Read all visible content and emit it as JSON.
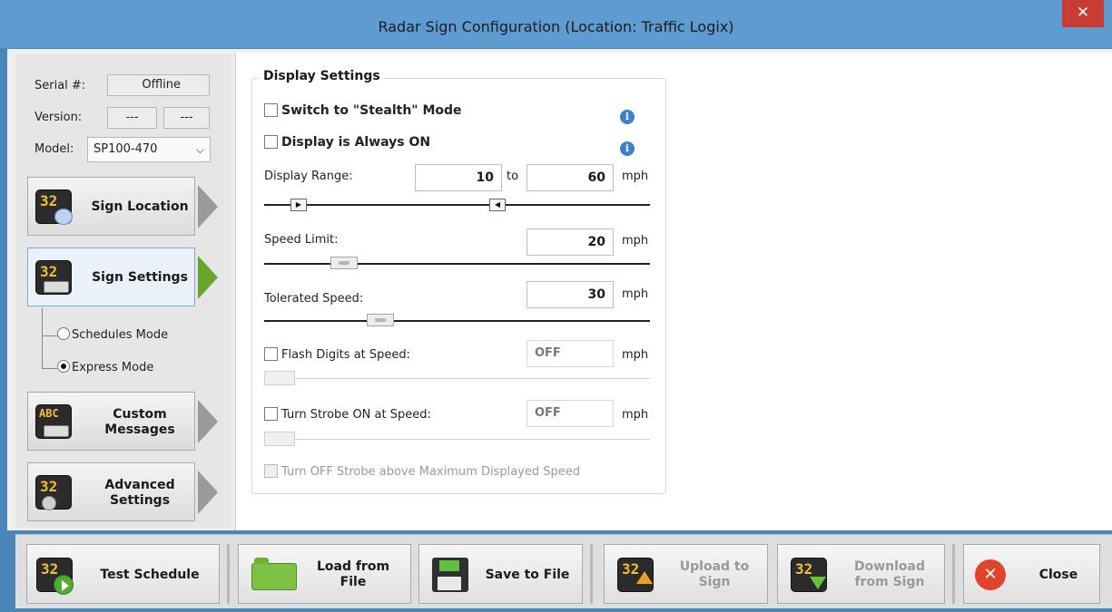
{
  "window": {
    "title": "Radar Sign Configuration (Location: Traffic Logix)",
    "close_glyph": "✕"
  },
  "device": {
    "serial_label": "Serial #:",
    "serial_value": "Offline",
    "version_label": "Version:",
    "version_value_1": "---",
    "version_value_2": "---",
    "model_label": "Model:",
    "model_value": "SP100-470"
  },
  "nav": {
    "items": [
      {
        "label": "Sign Location",
        "icon": "sign-globe-icon",
        "active": false
      },
      {
        "label": "Sign Settings",
        "icon": "sign-settings-icon",
        "active": true
      },
      {
        "label": "Custom\nMessages",
        "icon": "abc-messages-icon",
        "active": false
      },
      {
        "label": "Advanced\nSettings",
        "icon": "sign-gears-icon",
        "active": false
      }
    ],
    "modes": [
      {
        "label": "Schedules Mode",
        "checked": false
      },
      {
        "label": "Express Mode",
        "checked": true
      }
    ]
  },
  "sign_digits": "32",
  "abc_digits": "ABC",
  "display_settings": {
    "group_title": "Display Settings",
    "stealth_label": "Switch to \"Stealth\" Mode",
    "stealth_checked": false,
    "always_on_label": "Display is Always ON",
    "always_on_checked": false,
    "info_glyph": "i",
    "display_range_label": "Display Range:",
    "range_min": "10",
    "range_to": "to",
    "range_max": "60",
    "unit": "mph",
    "speed_limit_label": "Speed Limit:",
    "speed_limit": "20",
    "tolerated_label": "Tolerated Speed:",
    "tolerated": "30",
    "flash_label": "Flash Digits at Speed:",
    "flash_value": "OFF",
    "strobe_label": "Turn Strobe ON at Speed:",
    "strobe_value": "OFF",
    "strobe_off_label": "Turn OFF Strobe above Maximum Displayed Speed"
  },
  "toolbar": {
    "test_schedule": "Test Schedule",
    "load_from_file": "Load from\nFile",
    "save_to_file": "Save to File",
    "upload_to_sign": "Upload to\nSign",
    "download_from_sign": "Download\nfrom Sign",
    "close": "Close",
    "close_glyph": "✕"
  },
  "colors": {
    "title_bar": "#5e9bd0",
    "close_button": "#c73c33",
    "active_arrow": "#6aa52b",
    "inactive_arrow": "#9a9a9a",
    "info_icon": "#3d7fd0"
  }
}
